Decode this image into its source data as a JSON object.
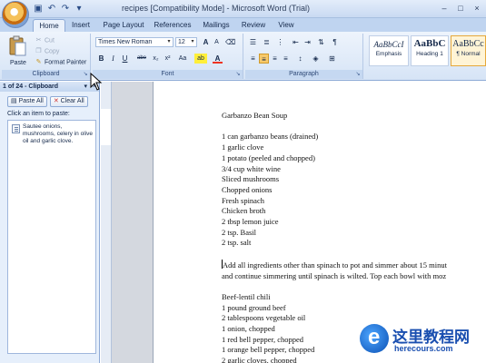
{
  "window": {
    "title": "recipes [Compatibility Mode] - Microsoft Word (Trial)",
    "controls": [
      "–",
      "□",
      "×"
    ]
  },
  "quick_access": [
    "save-icon",
    "undo-icon",
    "redo-icon",
    "customize-icon"
  ],
  "tabs": [
    "Home",
    "Insert",
    "Page Layout",
    "References",
    "Mailings",
    "Review",
    "View"
  ],
  "active_tab": "Home",
  "ribbon": {
    "clipboard": {
      "label": "Clipboard",
      "paste": "Paste",
      "cut": "Cut",
      "copy": "Copy",
      "format_painter": "Format Painter"
    },
    "font": {
      "label": "Font",
      "font_name": "Times New Roman",
      "font_size": "12",
      "bold": "B",
      "italic": "I",
      "underline": "U",
      "strike": "abe",
      "subscript": "x₂",
      "superscript": "x²",
      "change_case": "Aa",
      "highlight": "ab",
      "font_color": "A",
      "grow": "A",
      "shrink": "A"
    },
    "paragraph": {
      "label": "Paragraph"
    },
    "styles": [
      {
        "sample": "AaBbCcI",
        "name": "Emphasis"
      },
      {
        "sample": "AaBbC",
        "name": "Heading 1"
      },
      {
        "sample": "AaBbCc",
        "name": "¶ Normal"
      }
    ]
  },
  "clipboard_pane": {
    "title": "1 of 24 - Clipboard",
    "paste_all": "Paste All",
    "clear_all": "Clear All",
    "hint": "Click an item to paste:",
    "items": [
      "Sautee onions, mushrooms, celery in olive oil and garlic clove."
    ]
  },
  "document": {
    "lines": [
      "Garbanzo Bean Soup",
      "",
      "1 can garbanzo beans (drained)",
      "1 garlic clove",
      "1 potato (peeled and chopped)",
      "3/4 cup white wine",
      "Sliced mushrooms",
      "Chopped onions",
      "Fresh spinach",
      "Chicken broth",
      "2 tbsp lemon juice",
      "2 tsp. Basil",
      "2 tsp. salt",
      "",
      "Add all ingredients other than spinach to pot and simmer about 15 minut",
      "and continue simmering  until spinach is wilted. Top each bowl with moz",
      "",
      "Beef-lentil chili",
      "1 pound ground beef",
      "2 tablespoons vegetable oil",
      "1 onion, chopped",
      "1 red bell pepper, chopped",
      "1 orange bell pepper, chopped",
      "2 garlic cloves, chopped"
    ]
  },
  "watermark": {
    "title": "这里教程网",
    "url": "herecours.com"
  }
}
